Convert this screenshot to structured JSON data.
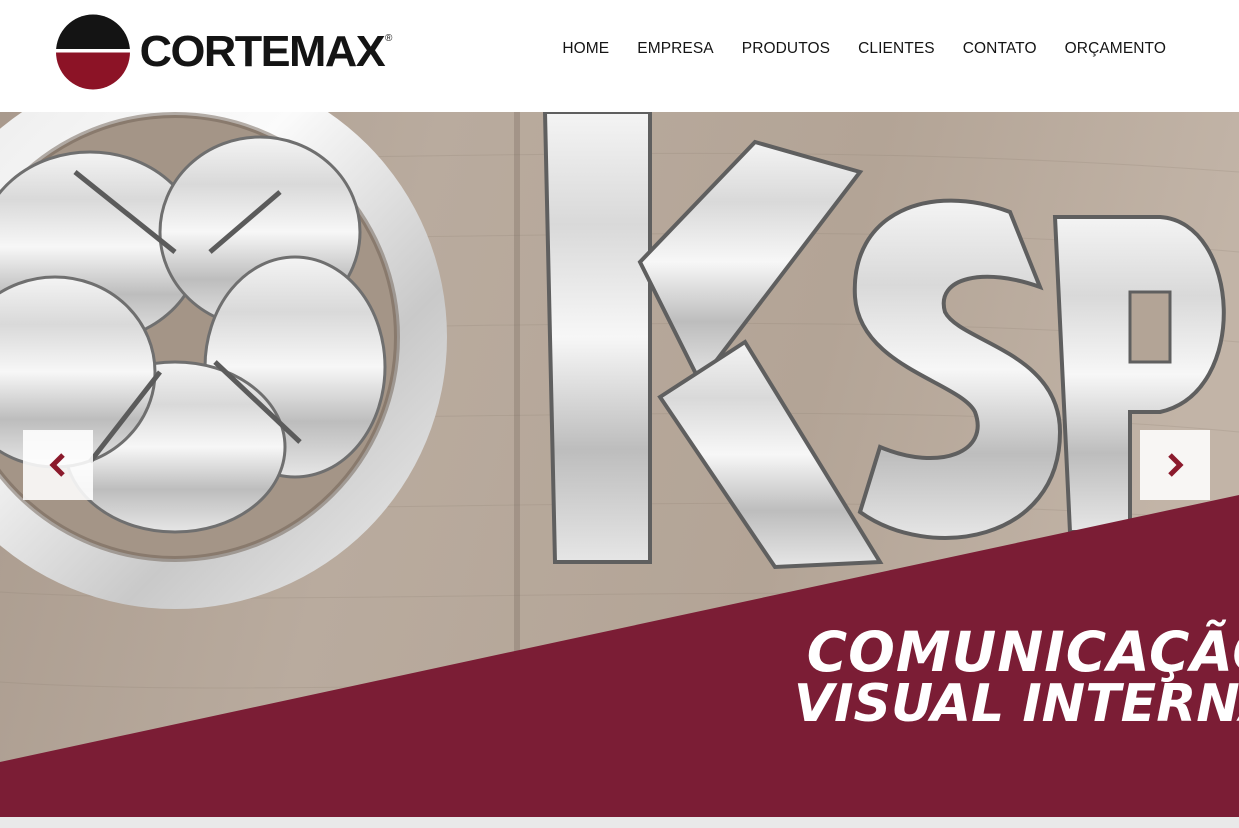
{
  "brand": {
    "name": "CORTEMAX",
    "registered_mark": "®",
    "colors": {
      "dark": "#141414",
      "accent": "#8c1326"
    }
  },
  "nav": {
    "items": [
      {
        "label": "HOME"
      },
      {
        "label": "EMPRESA"
      },
      {
        "label": "PRODUTOS"
      },
      {
        "label": "CLIENTES"
      },
      {
        "label": "CONTATO"
      },
      {
        "label": "ORÇAMENTO"
      }
    ]
  },
  "slider": {
    "prev_icon": "chevron-left-icon",
    "next_icon": "chevron-right-icon",
    "arrow_color": "#8b1a2c",
    "banner_color": "#7b1d35",
    "slide": {
      "photo": "steel-lettering-ksp-logo-on-wood-wall",
      "caption_line1": "COMUNICAÇÃO",
      "caption_line2": "VISUAL INTERNA"
    }
  }
}
